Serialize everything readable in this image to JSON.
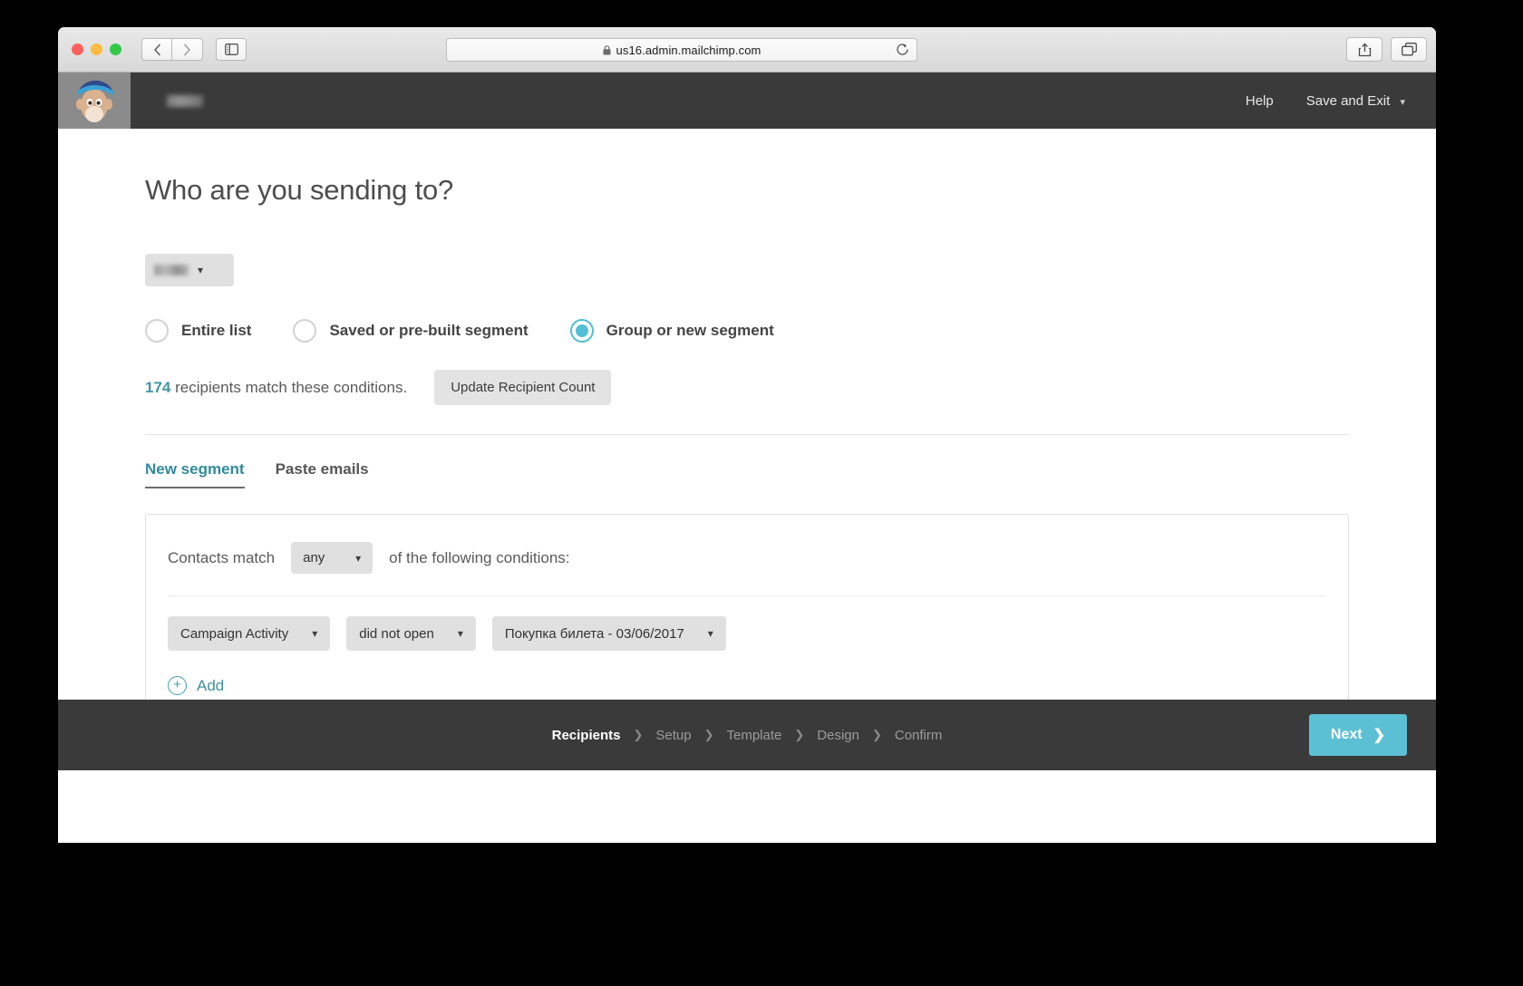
{
  "browser": {
    "url": "us16.admin.mailchimp.com",
    "lock_icon": "lock-icon",
    "back_icon": "chevron-left-icon",
    "forward_icon": "chevron-right-icon",
    "sidebar_icon": "sidebar-toggle-icon",
    "reload_icon": "reload-icon",
    "share_icon": "share-icon",
    "tabs_icon": "tab-overview-icon",
    "new_tab_icon": "plus-icon",
    "traffic_lights": [
      "close",
      "minimize",
      "zoom"
    ]
  },
  "app_header": {
    "logo_icon": "mailchimp-freddie-logo",
    "account_name_redacted": "",
    "help_label": "Help",
    "save_exit_label": "Save and Exit",
    "save_exit_caret": "chevron-down-icon"
  },
  "page": {
    "title": "Who are you sending to?",
    "list_selector": {
      "value_redacted": "",
      "caret_icon": "chevron-down-icon"
    },
    "audience_options": [
      {
        "label": "Entire list",
        "selected": false
      },
      {
        "label": "Saved or pre-built segment",
        "selected": false
      },
      {
        "label": "Group or new segment",
        "selected": true
      }
    ],
    "recipient_count": {
      "count": "174",
      "text": " recipients match these conditions.",
      "update_button": "Update Recipient Count"
    },
    "tabs": [
      {
        "label": "New segment",
        "active": true
      },
      {
        "label": "Paste emails",
        "active": false
      }
    ],
    "segment_builder": {
      "match_prefix": "Contacts match",
      "match_operator": "any",
      "match_operator_caret": "chevron-down-icon",
      "match_suffix": "of the following conditions:",
      "conditions": [
        {
          "field": "Campaign Activity",
          "operator": "did not open",
          "value": "Покупка билета - 03/06/2017"
        }
      ],
      "add_label": "Add",
      "add_icon": "plus-circle-icon"
    }
  },
  "footer": {
    "steps": [
      {
        "label": "Recipients",
        "current": true
      },
      {
        "label": "Setup",
        "current": false
      },
      {
        "label": "Template",
        "current": false
      },
      {
        "label": "Design",
        "current": false
      },
      {
        "label": "Confirm",
        "current": false
      }
    ],
    "separator": "❯",
    "next_label": "Next",
    "next_icon": "chevron-right-icon"
  },
  "colors": {
    "accent_teal": "#3f96a6",
    "radio_selected": "#53bfd6",
    "next_button": "#5cc0d4",
    "header_dark": "#3a3a3a",
    "logo_box": "#8b8b8b"
  }
}
